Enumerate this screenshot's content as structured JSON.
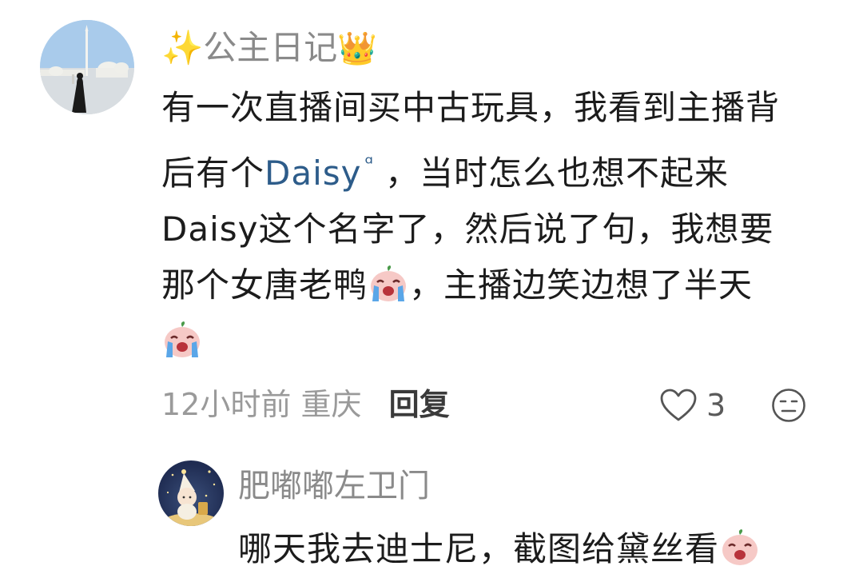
{
  "comment": {
    "username_sparkle": "✨",
    "username": "公主日记",
    "username_crown": "👑",
    "text_line1": "有一次直播间买中古玩具，我看到主播背",
    "text_line2_pre": "后有个",
    "link_text": "Daisy",
    "link_icon": "search-icon",
    "text_line2_post": "，当时怎么也想不起来",
    "text_line3": "Daisy这个名字了，然后说了句，我想要",
    "text_line4_pre": "那个女唐老鸭",
    "text_line4_post": "，主播边笑边想了半天",
    "time": "12小时前",
    "location": "重庆",
    "reply_label": "回复",
    "like_count": "3"
  },
  "reply": {
    "username": "肥嘟嘟左卫门",
    "text": "哪天我去迪士尼，截图给黛丝看"
  },
  "colors": {
    "link": "#2d5c8a",
    "username": "#8a8a8a",
    "body_text": "#1c1c1c",
    "meta": "#9a9a9a"
  }
}
